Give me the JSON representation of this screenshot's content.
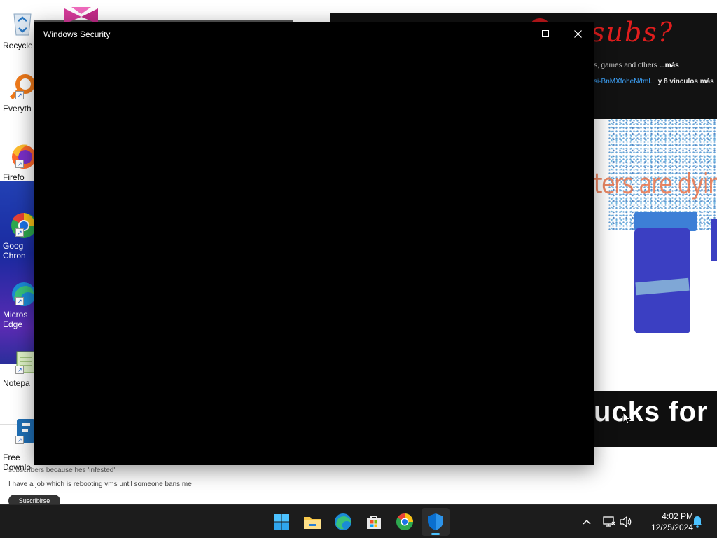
{
  "window": {
    "title": "Windows Security",
    "minimize_label": "",
    "maximize_label": "",
    "close_label": ""
  },
  "desktop": {
    "icons": [
      {
        "label": "Recycle"
      },
      {
        "label": "Everyth"
      },
      {
        "label": "Firefo"
      },
      {
        "label": "Goog",
        "label2": "Chron"
      },
      {
        "label": "Micros",
        "label2": "Edge"
      },
      {
        "label": "Notepa"
      },
      {
        "label": "Free",
        "label2": "Downlo"
      }
    ]
  },
  "background_window": {
    "title_fragment": "subs?",
    "description_start": "s, games and others",
    "description_more": "...más",
    "link_text": "si-BnMXfoheN/tml...",
    "link_more": "y 8 vínculos más",
    "art_text": "ters are dying",
    "banner_text": "ucks for m"
  },
  "background_left_window": {
    "line1": "subscribers because hes 'infested'",
    "line2": "I have a job which is rebooting vms until someone bans me",
    "pill": "Suscribirse"
  },
  "taskbar": {
    "apps": [
      "start",
      "file-explorer",
      "edge",
      "store",
      "chrome",
      "windows-security"
    ],
    "active_app": "windows-security",
    "time": "4:02 PM",
    "date": "12/25/2024"
  },
  "colors": {
    "accent": "#4cc2ff",
    "taskbar_bg": "#1c1c1c",
    "security_window_bg": "#000000",
    "shield_blue": "#0a6fcf"
  }
}
